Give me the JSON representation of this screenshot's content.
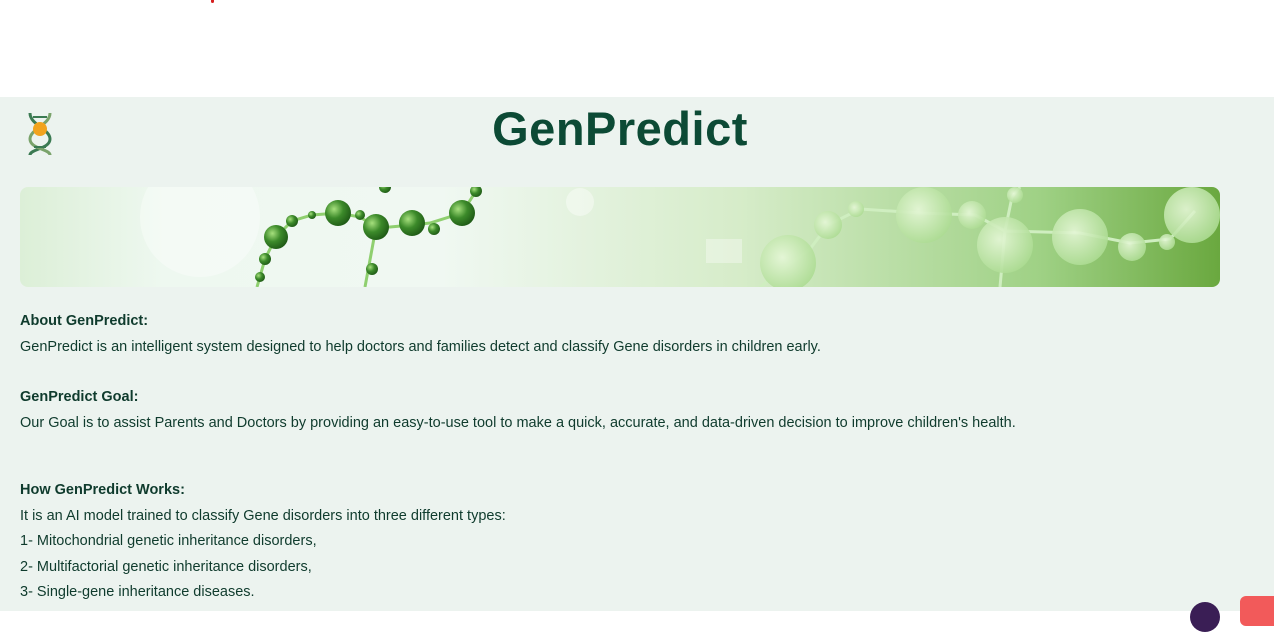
{
  "app": {
    "title": "GenPredict"
  },
  "about": {
    "heading": "About GenPredict:",
    "text": "GenPredict is an intelligent system designed to help doctors and families detect and classify Gene disorders in children early."
  },
  "goal": {
    "heading": "GenPredict Goal:",
    "text": "Our Goal is to assist Parents and Doctors by providing an easy-to-use tool to make a quick, accurate, and data-driven decision to improve children's health."
  },
  "works": {
    "heading": "How GenPredict Works:",
    "intro": "It is an AI model trained to classify Gene disorders into three different types:",
    "items": [
      "1- Mitochondrial genetic inheritance disorders,",
      "2- Multifactorial genetic inheritance disorders,",
      "3- Single-gene inheritance diseases."
    ]
  },
  "icons": {
    "logo": "dna-icon",
    "banner": "molecule-banner-image"
  },
  "colors": {
    "background": "#ecf3ef",
    "title": "#0c4a35",
    "text": "#0f3b2d",
    "accent": "#4caf50"
  }
}
